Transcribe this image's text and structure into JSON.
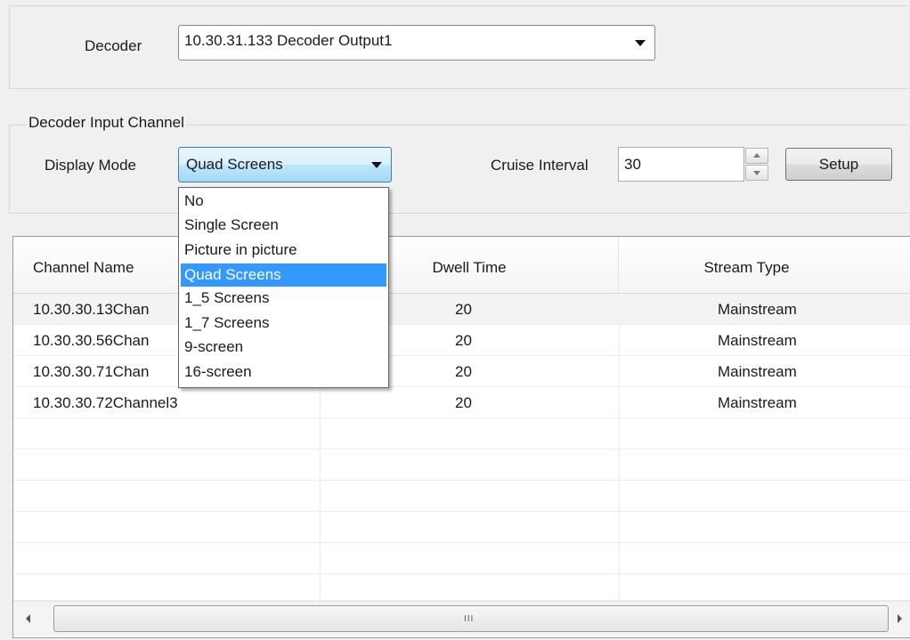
{
  "decoder": {
    "label": "Decoder",
    "selected": "10.30.31.133 Decoder Output1"
  },
  "input_channel": {
    "group_title": "Decoder Input Channel",
    "display_mode_label": "Display Mode",
    "display_mode_selected": "Quad Screens",
    "cruise_interval_label": "Cruise Interval",
    "cruise_interval_value": "30",
    "setup_button": "Setup"
  },
  "dropdown": {
    "options": [
      "No",
      "Single Screen",
      "Picture in picture",
      "Quad Screens",
      "1_5 Screens",
      "1_7 Screens",
      "9-screen",
      "16-screen"
    ],
    "selected_index": 3
  },
  "table": {
    "headers": [
      "Channel Name",
      "Dwell Time",
      "Stream Type"
    ],
    "rows": [
      [
        "10.30.30.13Chan",
        "20",
        "Mainstream"
      ],
      [
        "10.30.30.56Chan",
        "20",
        "Mainstream"
      ],
      [
        "10.30.30.71Chan",
        "20",
        "Mainstream"
      ],
      [
        "10.30.30.72Channel3",
        "20",
        "Mainstream"
      ]
    ]
  },
  "scrollbar": {
    "grip": "III"
  },
  "colors": {
    "selection": "#3399ff",
    "combo_focus": "#3c7fb1"
  }
}
